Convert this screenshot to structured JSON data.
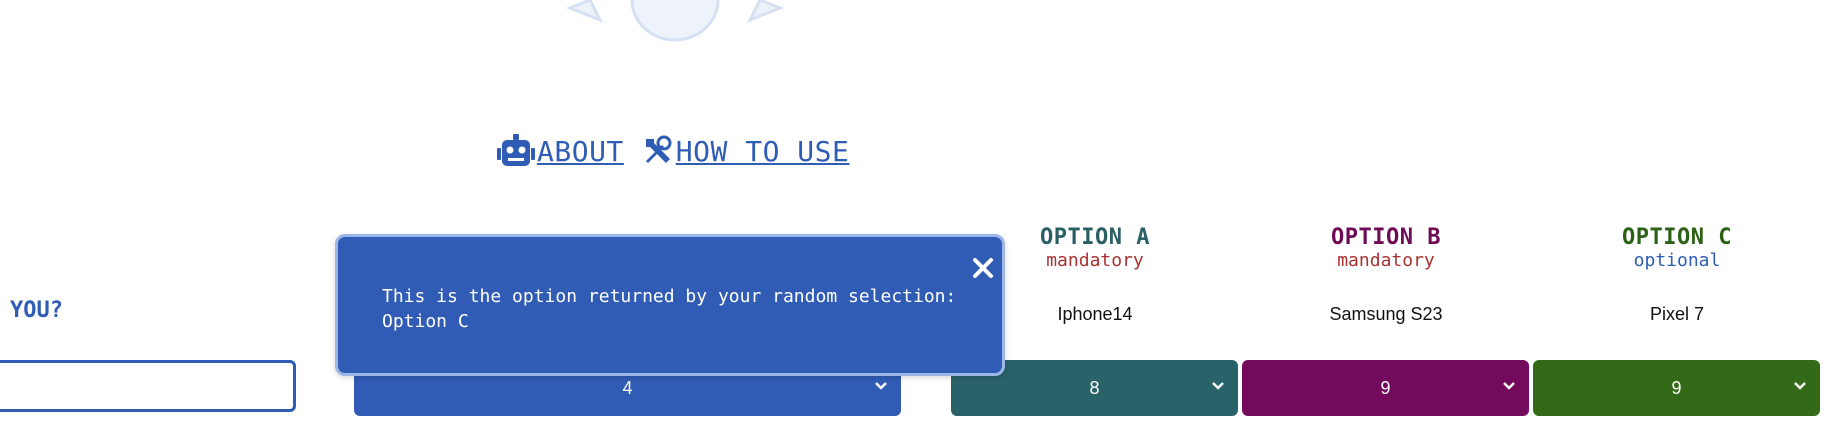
{
  "nav": {
    "about_label": " ABOUT",
    "howto_label": " HOW TO USE"
  },
  "columns": [
    {
      "option": "OPTION A",
      "requirement": "mandatory",
      "product": "Iphone14",
      "value": "8",
      "color": "#2a626a",
      "option_color": "#2a5f66",
      "req_color": "#a83232"
    },
    {
      "option": "OPTION B",
      "requirement": "mandatory",
      "product": "Samsung S23",
      "value": "9",
      "color": "#730a5b",
      "option_color": "#6f0a57",
      "req_color": "#a83232"
    },
    {
      "option": "OPTION C",
      "requirement": "optional",
      "product": "Pixel 7",
      "value": "9",
      "color": "#326a18",
      "option_color": "#2c6215",
      "req_color": "#2f5cb5"
    }
  ],
  "left": {
    "you_label": "YOU?",
    "weight_value": "4"
  },
  "popup": {
    "message_line1": "This is the option returned by your random selection:",
    "message_line2": "Option C"
  },
  "colors": {
    "primary": "#315cb6",
    "popup_border": "#9db6e8"
  }
}
